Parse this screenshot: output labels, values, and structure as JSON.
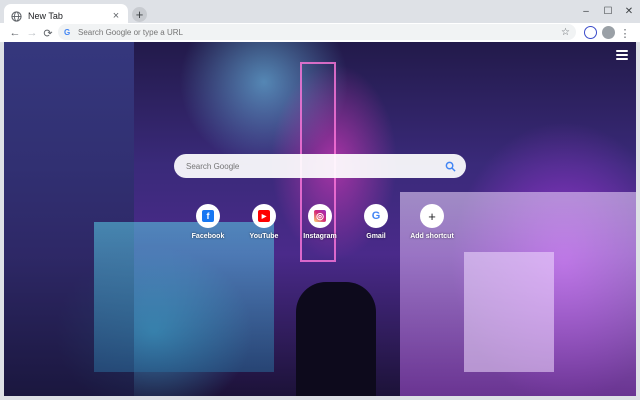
{
  "tab": {
    "title": "New Tab",
    "close": "×"
  },
  "newtab": "+",
  "window_controls": {
    "minimize": "–",
    "maximize": "☐",
    "close": "✕"
  },
  "nav": {
    "back": "←",
    "forward": "→",
    "reload": "⟳"
  },
  "omnibox": {
    "placeholder": "Search Google or type a URL",
    "star": "☆"
  },
  "toolbar_menu": "⋮",
  "search": {
    "placeholder": "Search Google"
  },
  "shortcuts": [
    {
      "label": "Facebook",
      "icon": "facebook-icon",
      "glyph": "f",
      "color": "#1877f2"
    },
    {
      "label": "YouTube",
      "icon": "youtube-icon",
      "glyph": "▶",
      "color": "#ff0000"
    },
    {
      "label": "Instagram",
      "icon": "instagram-icon",
      "glyph": "◎",
      "color": "#c13584"
    },
    {
      "label": "Gmail",
      "icon": "google-icon",
      "glyph": "G",
      "color": "#4285f4"
    },
    {
      "label": "Add shortcut",
      "icon": "plus-icon",
      "glyph": "+",
      "color": "#202124"
    }
  ],
  "colors": {
    "accent": "#4285f4",
    "tabstrip": "#dee1e6"
  }
}
